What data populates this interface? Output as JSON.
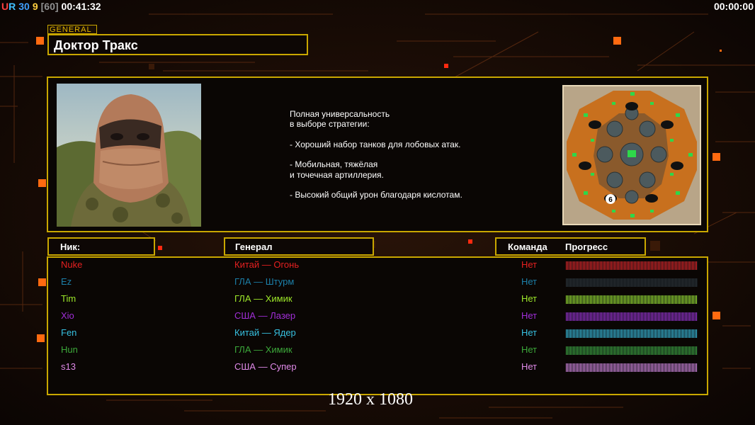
{
  "hud": {
    "left_items": [
      {
        "text": "U",
        "color": "#ff4040"
      },
      {
        "text": "R",
        "color": "#40c0ff"
      },
      {
        "text": "30",
        "color": "#40a0ff"
      },
      {
        "text": "9",
        "color": "#ffd040"
      },
      {
        "text": "[60]",
        "color": "#909090"
      },
      {
        "text": "00:41:32",
        "color": "#ffffff"
      }
    ],
    "right_timer": "00:00:00"
  },
  "general_tag": "GENERAL",
  "general_name": "Доктор Тракс",
  "description": "Полная универсальность\nв выборе стратегии:\n\n- Хороший набор танков для лобовых атак.\n\n- Мобильная, тяжёлая\nи точечная артиллерия.\n\n- Высокий общий урон благодаря кислотам.",
  "minimap": {
    "badge": "6"
  },
  "headers": {
    "nick": "Ник:",
    "general": "Генерал",
    "team": "Команда",
    "progress": "Прогресс"
  },
  "players": [
    {
      "nick": "Nuke",
      "general": "Китай — Огонь",
      "team": "Нет",
      "color": "#e52020",
      "progress": 1.0
    },
    {
      "nick": "Ez",
      "general": "ГЛА — Штурм",
      "team": "Нет",
      "color": "#1c7fa8",
      "progress": 0.0
    },
    {
      "nick": "Tim",
      "general": "ГЛА — Химик",
      "team": "Нет",
      "color": "#9ee82a",
      "progress": 1.0
    },
    {
      "nick": "Xio",
      "general": "США — Лазер",
      "team": "Нет",
      "color": "#a12ed8",
      "progress": 1.0
    },
    {
      "nick": "Fen",
      "general": "Китай — Ядер",
      "team": "Нет",
      "color": "#37c0e0",
      "progress": 1.0
    },
    {
      "nick": "Hun",
      "general": "ГЛА — Химик",
      "team": "Нет",
      "color": "#3ca83a",
      "progress": 1.0
    },
    {
      "nick": "s13",
      "general": "США — Супер",
      "team": "Нет",
      "color": "#e08ae8",
      "progress": 1.0
    }
  ],
  "resolution": "1920 x 1080"
}
